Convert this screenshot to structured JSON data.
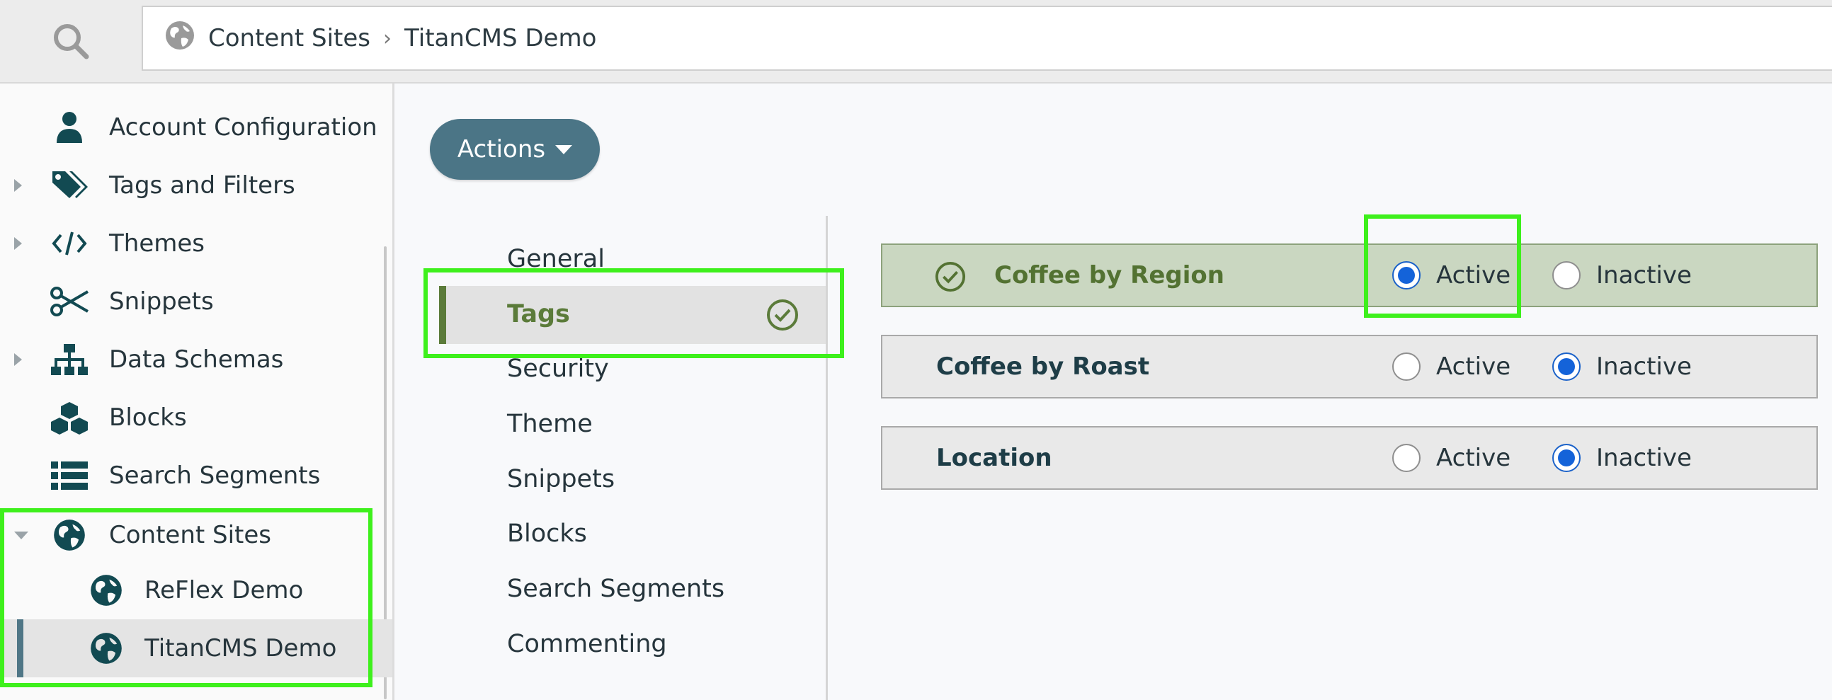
{
  "breadcrumb": {
    "items": [
      "Content Sites",
      "TitanCMS Demo"
    ]
  },
  "sidebar": {
    "items": [
      {
        "label": "Account Configuration",
        "icon": "user-icon",
        "caret": "none"
      },
      {
        "label": "Tags and Filters",
        "icon": "tags-icon",
        "caret": "right"
      },
      {
        "label": "Themes",
        "icon": "code-icon",
        "caret": "right"
      },
      {
        "label": "Snippets",
        "icon": "scissors-icon",
        "caret": "none"
      },
      {
        "label": "Data Schemas",
        "icon": "sitemap-icon",
        "caret": "right"
      },
      {
        "label": "Blocks",
        "icon": "cubes-icon",
        "caret": "none"
      },
      {
        "label": "Search Segments",
        "icon": "list-icon",
        "caret": "none"
      },
      {
        "label": "Content Sites",
        "icon": "globe-icon",
        "caret": "down"
      },
      {
        "label": "ReFlex Demo",
        "icon": "globe-icon",
        "caret": "none"
      },
      {
        "label": "TitanCMS Demo",
        "icon": "globe-icon",
        "caret": "none",
        "selected": true
      }
    ]
  },
  "actions": {
    "label": "Actions"
  },
  "subnav": {
    "items": [
      "General",
      "Tags",
      "Security",
      "Theme",
      "Snippets",
      "Blocks",
      "Search Segments",
      "Commenting"
    ],
    "active": "Tags"
  },
  "tags": {
    "option_active": "Active",
    "option_inactive": "Inactive",
    "rows": [
      {
        "name": "Coffee by Region",
        "state": "Active"
      },
      {
        "name": "Coffee by Roast",
        "state": "Inactive"
      },
      {
        "name": "Location",
        "state": "Inactive"
      }
    ]
  },
  "colors": {
    "accent_teal": "#4b7586",
    "active_green": "#5b7b3a",
    "radio_blue": "#1463d9",
    "highlight_green": "#3ef01c"
  }
}
